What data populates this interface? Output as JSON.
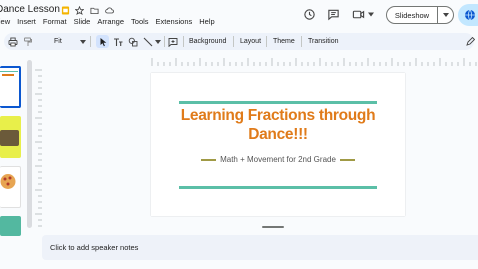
{
  "app": {
    "doc_title": "Dance Lesson"
  },
  "menu": [
    "View",
    "Insert",
    "Format",
    "Slide",
    "Arrange",
    "Tools",
    "Extensions",
    "Help"
  ],
  "header": {
    "slideshow_label": "Slideshow"
  },
  "toolbar": {
    "zoom_label": "Fit",
    "background_label": "Background",
    "layout_label": "Layout",
    "theme_label": "Theme",
    "transition_label": "Transition"
  },
  "slide": {
    "title_line1": "Learning Fractions through",
    "title_line2": "Dance!!!",
    "subtitle": "Math + Movement for 2nd Grade"
  },
  "notes": {
    "placeholder": "Click to add speaker notes"
  },
  "colors": {
    "accent_blue": "#0b57d0",
    "title_orange": "#e07b1a",
    "line_teal": "#5bbfa7",
    "dash_olive": "#a09a45",
    "share_bg": "#c2e7ff",
    "toolbar_bg": "#edf2fa"
  },
  "icons": {
    "title_bar": [
      "slides-logo-icon",
      "star-icon",
      "move-to-folder-icon",
      "cloud-status-icon"
    ],
    "header": [
      "history-icon",
      "comment-icon",
      "camera-icon",
      "dropdown-caret-icon"
    ],
    "toolbar": [
      "print-icon",
      "paint-format-icon",
      "select-cursor-icon",
      "text-box-icon",
      "shape-icon",
      "line-icon",
      "add-comment-icon",
      "pen-icon"
    ]
  }
}
